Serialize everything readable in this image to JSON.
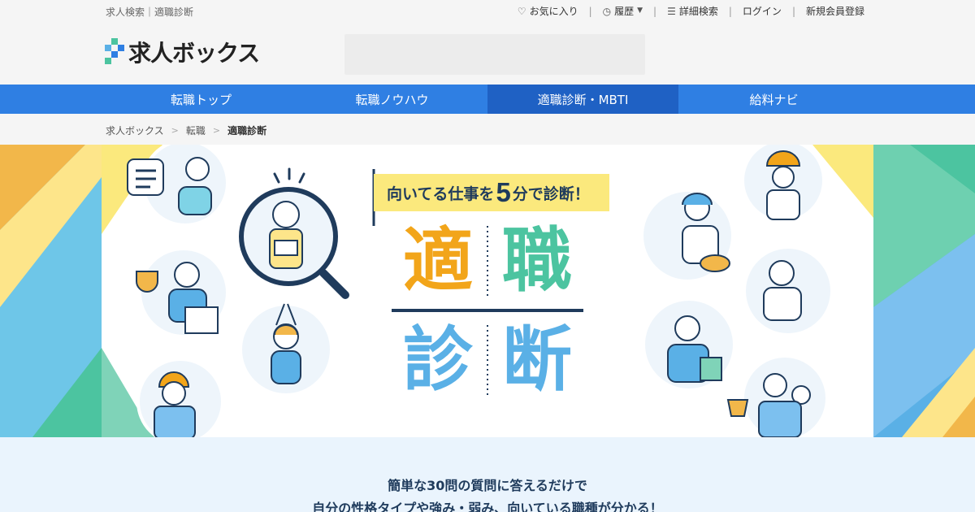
{
  "util_bar": {
    "site_desc": "求人検索｜適職診断",
    "favorites": "お気に入り",
    "history": "履歴",
    "advanced_search": "詳細検索",
    "login": "ログイン",
    "register": "新規会員登録"
  },
  "header": {
    "logo_text": "求人ボックス"
  },
  "gnav": {
    "items": [
      {
        "label": "転職トップ"
      },
      {
        "label": "転職ノウハウ"
      },
      {
        "label": "適職診断・MBTI"
      },
      {
        "label": "給料ナビ"
      }
    ],
    "active_index": 2
  },
  "breadcrumb": {
    "items": [
      "求人ボックス",
      "転職",
      "適職診断"
    ]
  },
  "hero": {
    "tagline_prefix": "向いてる仕事を",
    "tagline_number": "5",
    "tagline_suffix": "分で診断！",
    "char_1": "適",
    "char_2": "職",
    "char_3": "診",
    "char_4": "断"
  },
  "intro": {
    "line1": "簡単な30問の質問に答えるだけで",
    "line2": "自分の性格タイプや強み・弱み、向いている職種が分かる！"
  },
  "colors": {
    "nav_blue": "#2f7fe3",
    "nav_active": "#1f61c4",
    "orange": "#f2a51a",
    "green": "#4cc4a0",
    "light_blue": "#5ab0e6",
    "navy": "#1f3b5c",
    "yellow": "#fbe97d"
  },
  "icons": [
    "heart-icon",
    "clock-icon",
    "caret-down-icon",
    "filter-search-icon",
    "chevron-right-icon"
  ]
}
